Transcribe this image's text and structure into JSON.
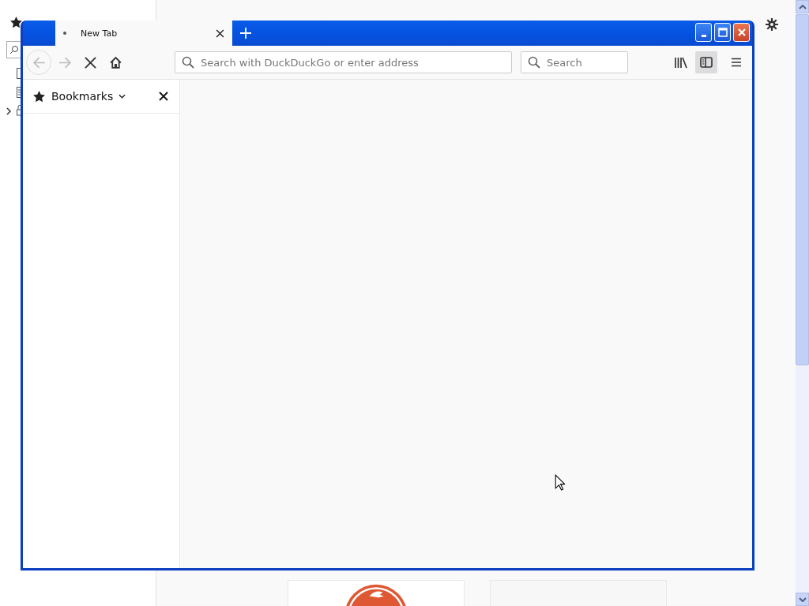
{
  "window": {
    "tabs": [
      {
        "label": "New Tab",
        "selected": true,
        "loading": true
      }
    ],
    "nav_buttons": [
      {
        "kind": "back",
        "disabled": true
      },
      {
        "kind": "forward",
        "disabled": true
      },
      {
        "kind": "stop",
        "disabled": false
      },
      {
        "kind": "home",
        "disabled": false
      }
    ],
    "address_bar": {
      "placeholder": "Search with DuckDuckGo or enter address"
    },
    "search_bar": {
      "placeholder": "Search"
    },
    "tools": [
      {
        "kind": "library",
        "on": false
      },
      {
        "kind": "sidebar",
        "on": true
      },
      {
        "kind": "menu",
        "on": false
      }
    ],
    "sidebar": {
      "title": "Bookmarks"
    }
  }
}
